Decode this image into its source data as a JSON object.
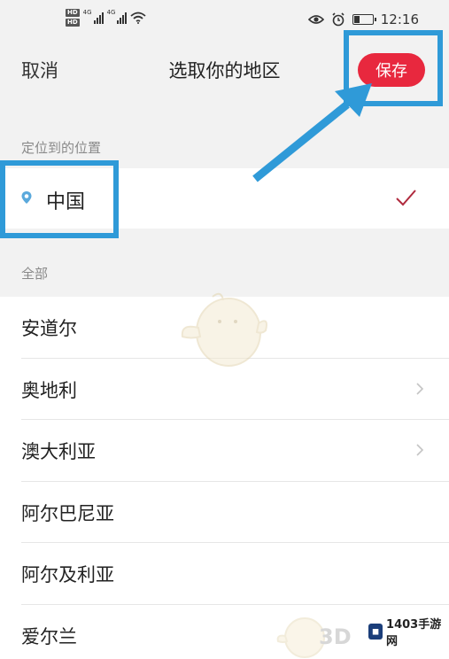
{
  "status_bar": {
    "hd_badge": "HD",
    "network_type": "4G",
    "time": "12:16",
    "battery_level": 0.35
  },
  "header": {
    "cancel_label": "取消",
    "title": "选取你的地区",
    "save_label": "保存"
  },
  "located_section": {
    "label": "定位到的位置",
    "current": "中国",
    "selected": true
  },
  "all_section": {
    "label": "全部",
    "items": [
      {
        "label": "安道尔",
        "has_chevron": false
      },
      {
        "label": "奥地利",
        "has_chevron": true
      },
      {
        "label": "澳大利亚",
        "has_chevron": true
      },
      {
        "label": "阿尔巴尼亚",
        "has_chevron": false
      },
      {
        "label": "阿尔及利亚",
        "has_chevron": false
      },
      {
        "label": "爱尔兰",
        "has_chevron": false
      }
    ]
  },
  "watermark": {
    "brand": "1403手游网",
    "logo_text": "3D"
  },
  "colors": {
    "accent_red": "#e8283e",
    "annotation_blue": "#2f9ad8",
    "check_color": "#b02a3e"
  }
}
